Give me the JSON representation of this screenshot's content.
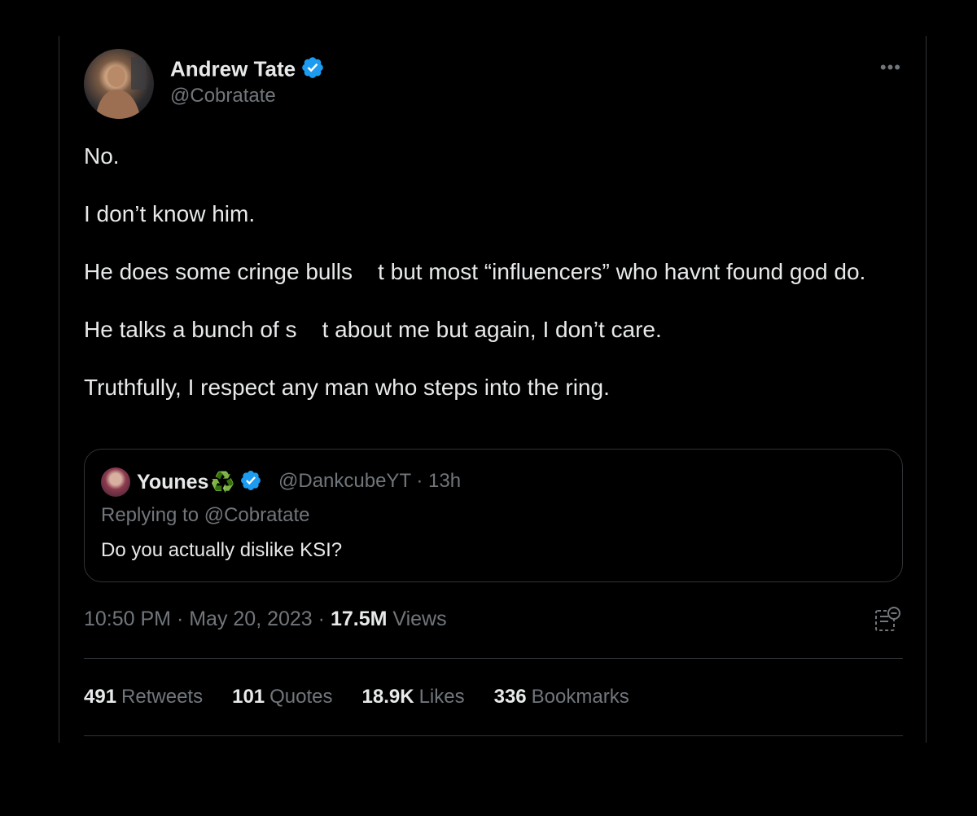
{
  "author": {
    "display_name": "Andrew Tate",
    "handle": "@Cobratate",
    "avatar_icon": "profile-photo",
    "verified_color": "#1d9bf0"
  },
  "more_label": "•••",
  "tweet": {
    "paragraphs": [
      "No.",
      "I don’t know him.",
      "He does some cringe bulls    t but most “influencers” who havnt found god do.",
      "He talks a bunch of s    t about me but again, I don’t care.",
      "Truthfully, I respect any man who steps into the ring."
    ]
  },
  "quoted_tweet": {
    "display_name": "Younes",
    "name_emoji": "♻️",
    "handle_time": "@DankcubeYT · 13h",
    "replying_to": "Replying to @Cobratate",
    "text": "Do you actually dislike KSI?"
  },
  "meta": {
    "time_date": "10:50 PM · May 20, 2023 · ",
    "views_count": "17.5M",
    "views_label": " Views"
  },
  "stats": [
    {
      "count": "491",
      "label": "Retweets"
    },
    {
      "count": "101",
      "label": "Quotes"
    },
    {
      "count": "18.9K",
      "label": "Likes"
    },
    {
      "count": "336",
      "label": "Bookmarks"
    }
  ],
  "colors": {
    "background": "#000000",
    "text_primary": "#e7e9ea",
    "text_secondary": "#71767b",
    "border": "#2f3336",
    "verified": "#1d9bf0"
  }
}
